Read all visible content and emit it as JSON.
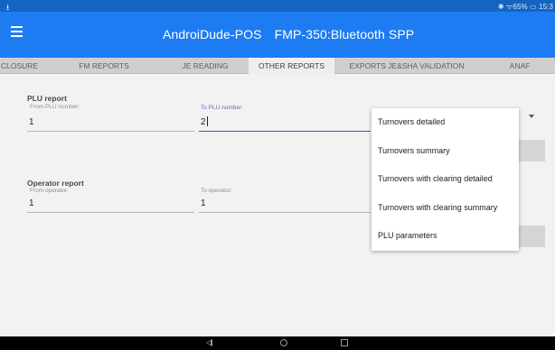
{
  "status_bar": {
    "left_icon": "download-arrow-icon",
    "right_text": "✱ ᯤ65% ▭ 15:3"
  },
  "app_bar": {
    "menu_icon": "hamburger-menu-icon",
    "app_name": "AndroiDude-POS",
    "device": "FMP-350:Bluetooth SPP"
  },
  "tabs": [
    {
      "label": "CLOSURE"
    },
    {
      "label": "FM REPORTS"
    },
    {
      "label": "JE READING"
    },
    {
      "label": "OTHER REPORTS",
      "active": true
    },
    {
      "label": "EXPORTS JE&SHA VALIDATION"
    },
    {
      "label": "ANAF"
    }
  ],
  "plu_report": {
    "title": "PLU report",
    "from_label": "From PLU number:",
    "from_value": "1",
    "to_label": "To PLU number:",
    "to_value": "2"
  },
  "operator_report": {
    "title": "Operator report",
    "from_label": "From operator:",
    "from_value": "1",
    "to_label": "To operator:",
    "to_value": "1"
  },
  "dropdown_menu": {
    "items": [
      "Turnovers detailed",
      "Turnovers summary",
      "Turnovers with clearing detailed",
      "Turnovers with clearing summary",
      "PLU parameters"
    ]
  },
  "colors": {
    "status_bar": "#1565c0",
    "app_bar": "#1e7cf3",
    "focus_accent": "#3f51b5"
  }
}
